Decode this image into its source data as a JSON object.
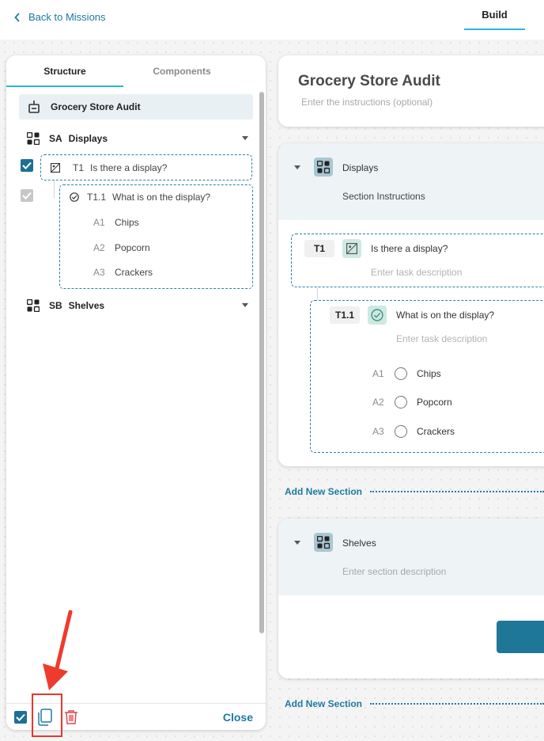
{
  "topbar": {
    "back_label": "Back to Missions",
    "tab_build": "Build"
  },
  "left_panel": {
    "tabs": {
      "structure": "Structure",
      "components": "Components"
    },
    "audit_title": "Grocery Store Audit",
    "sections": [
      {
        "code": "SA",
        "name": "Displays"
      },
      {
        "code": "SB",
        "name": "Shelves"
      }
    ],
    "task": {
      "code": "T1",
      "label": "Is there a display?"
    },
    "subtask": {
      "code": "T1.1",
      "label": "What is on the display?",
      "answers": [
        {
          "code": "A1",
          "label": "Chips"
        },
        {
          "code": "A2",
          "label": "Popcorn"
        },
        {
          "code": "A3",
          "label": "Crackers"
        }
      ]
    },
    "footer": {
      "close_label": "Close"
    }
  },
  "main": {
    "title": "Grocery Store Audit",
    "instructions_placeholder": "Enter the instructions (optional)",
    "section1": {
      "name": "Displays",
      "instructions": "Section Instructions",
      "task": {
        "tag": "T1",
        "title": "Is there a display?",
        "desc_placeholder": "Enter task description"
      },
      "subtask": {
        "tag": "T1.1",
        "title": "What is on the display?",
        "desc_placeholder": "Enter task description",
        "options": [
          {
            "code": "A1",
            "label": "Chips"
          },
          {
            "code": "A2",
            "label": "Popcorn"
          },
          {
            "code": "A3",
            "label": "Crackers"
          }
        ]
      }
    },
    "add_section_label": "Add New Section",
    "section2": {
      "name": "Shelves",
      "desc_placeholder": "Enter section description"
    }
  },
  "colors": {
    "accent": "#1d7aa0",
    "tab_underline": "#2bb7d6",
    "annotation": "#e8372c"
  }
}
